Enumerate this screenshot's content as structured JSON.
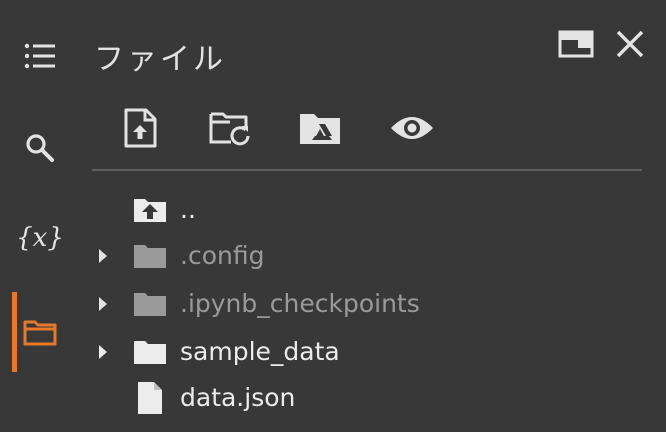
{
  "panel": {
    "title": "ファイル"
  },
  "rail": {
    "items": [
      {
        "icon": "toc-list-icon"
      },
      {
        "icon": "search-icon"
      },
      {
        "icon": "variables-icon",
        "glyph": "{x}"
      },
      {
        "icon": "folder-icon",
        "active": true
      }
    ]
  },
  "header_actions": {
    "open_in_tab_icon": "open-in-tab-icon",
    "close_icon": "close-icon"
  },
  "toolbar": {
    "items": [
      {
        "icon": "upload-file-icon"
      },
      {
        "icon": "refresh-folder-icon"
      },
      {
        "icon": "mount-drive-icon"
      },
      {
        "icon": "show-hidden-files-icon"
      }
    ]
  },
  "files": [
    {
      "name": "..",
      "type": "parent",
      "icon": "folder-up-icon",
      "expandable": false,
      "dimmed": false
    },
    {
      "name": ".config",
      "type": "folder",
      "icon": "folder-icon",
      "expandable": true,
      "dimmed": true
    },
    {
      "name": ".ipynb_checkpoints",
      "type": "folder",
      "icon": "folder-icon",
      "expandable": true,
      "dimmed": true
    },
    {
      "name": "sample_data",
      "type": "folder",
      "icon": "folder-icon",
      "expandable": true,
      "dimmed": false
    },
    {
      "name": "data.json",
      "type": "file",
      "icon": "file-icon",
      "expandable": false,
      "dimmed": false
    }
  ],
  "colors": {
    "background": "#383838",
    "text": "#e3e3e3",
    "dim_text": "#9a9a9a",
    "accent": "#e8782a",
    "divider": "#5f5f5f"
  }
}
